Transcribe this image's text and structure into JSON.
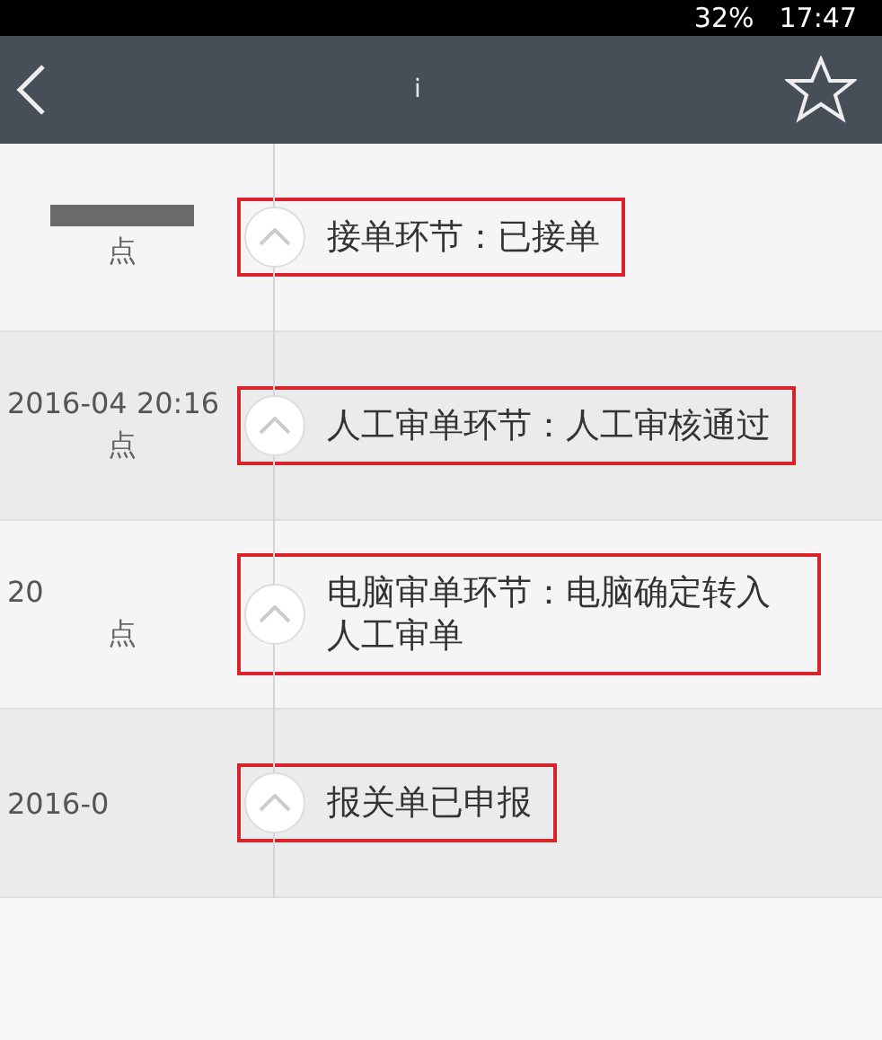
{
  "status_bar": {
    "battery": "32%",
    "time": "17:47"
  },
  "header": {
    "title": "i"
  },
  "events": [
    {
      "date_suffix": "点",
      "label": "接单环节：已接单",
      "highlighted": true
    },
    {
      "time": "2016-04 20:16",
      "date_suffix": "点",
      "label": "人工审单环节：人工审核通过",
      "highlighted": true
    },
    {
      "time": "20",
      "date_suffix": "点",
      "label": "电脑审单环节：电脑确定转入人工审单",
      "highlighted": true
    },
    {
      "time": "2016-0",
      "label": "报关单已申报",
      "highlighted": true
    }
  ]
}
